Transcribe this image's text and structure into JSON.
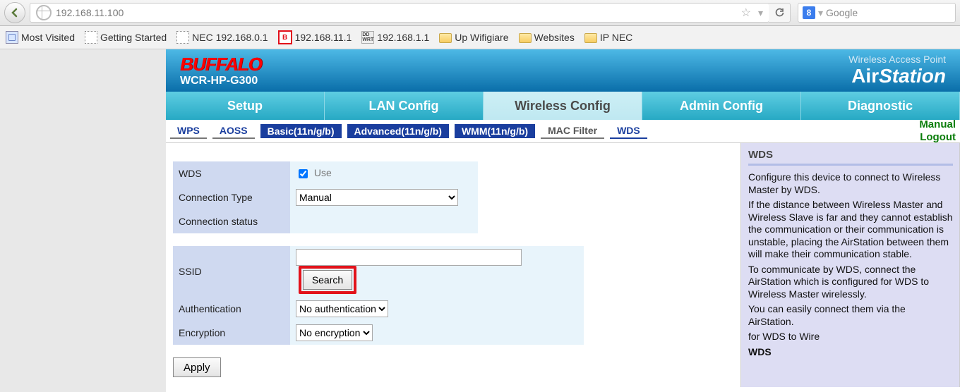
{
  "browser": {
    "url": "192.168.11.100",
    "search_placeholder": "Google"
  },
  "bookmarks": [
    {
      "kind": "blue",
      "label": "Most Visited"
    },
    {
      "kind": "dotted",
      "label": "Getting Started"
    },
    {
      "kind": "dotted",
      "label": "NEC 192.168.0.1"
    },
    {
      "kind": "red",
      "glyph": "B",
      "label": "192.168.11.1"
    },
    {
      "kind": "ddwrt",
      "glyph": "DD\nWRT",
      "label": "192.168.1.1"
    },
    {
      "kind": "folder",
      "label": "Up Wifigiare"
    },
    {
      "kind": "folder",
      "label": "Websites"
    },
    {
      "kind": "folder",
      "label": "IP NEC"
    }
  ],
  "header": {
    "brand": "BUFFALO",
    "model": "WCR-HP-G300",
    "tagline": "Wireless Access Point",
    "product": "AirStation"
  },
  "main_tabs": {
    "items": [
      "Setup",
      "LAN Config",
      "Wireless Config",
      "Admin Config",
      "Diagnostic"
    ],
    "active": 2
  },
  "sub_tabs": {
    "wps": "WPS",
    "aoss": "AOSS",
    "basic": "Basic(11n/g/b)",
    "adv": "Advanced(11n/g/b)",
    "wmm": "WMM(11n/g/b)",
    "mac": "MAC Filter",
    "wds": "WDS",
    "manual_link": "Manual",
    "logout_link": "Logout"
  },
  "form": {
    "wds_label": "WDS",
    "use_label": "Use",
    "conn_type_label": "Connection Type",
    "conn_type_value": "Manual",
    "conn_status_label": "Connection status",
    "conn_status_value": "",
    "ssid_label": "SSID",
    "ssid_value": "",
    "search_btn": "Search",
    "auth_label": "Authentication",
    "auth_value": "No authentication",
    "enc_label": "Encryption",
    "enc_value": "No encryption",
    "apply_btn": "Apply"
  },
  "side": {
    "title": "WDS",
    "p1": "Configure this device to connect to Wireless Master by WDS.",
    "p2": "If the distance between Wireless Master and Wireless Slave is far and they cannot establish the communication or their communication is unstable, placing the AirStation between them will make their communication stable.",
    "p3": "To communicate by WDS, connect the AirStation which is configured for WDS to Wireless Master wirelessly.",
    "p4": "You can easily connect them via the AirStation.",
    "p5": "for WDS to Wire",
    "foot": "WDS"
  }
}
